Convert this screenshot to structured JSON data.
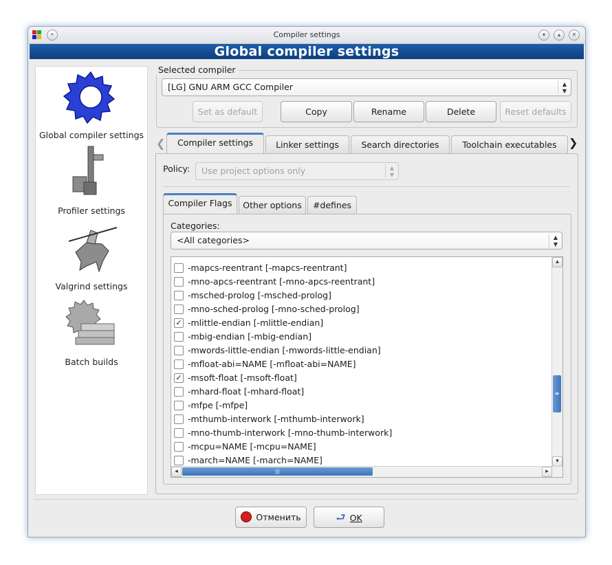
{
  "window": {
    "title": "Compiler settings",
    "banner": "Global compiler settings"
  },
  "sidebar": {
    "items": [
      {
        "label": "Global compiler settings",
        "icon": "gear-icon"
      },
      {
        "label": "Profiler settings",
        "icon": "profiler-icon"
      },
      {
        "label": "Valgrind settings",
        "icon": "valgrind-icon"
      },
      {
        "label": "Batch builds",
        "icon": "batch-builds-icon"
      }
    ]
  },
  "selected_compiler": {
    "legend": "Selected compiler",
    "value": "[LG] GNU ARM GCC Compiler",
    "buttons": {
      "set_default": "Set as default",
      "copy": "Copy",
      "rename": "Rename",
      "delete": "Delete",
      "reset_defaults": "Reset defaults"
    }
  },
  "tabs": [
    "Compiler settings",
    "Linker settings",
    "Search directories",
    "Toolchain executables"
  ],
  "policy": {
    "label": "Policy:",
    "value": "Use project options only"
  },
  "subtabs": [
    "Compiler Flags",
    "Other options",
    "#defines"
  ],
  "categories": {
    "label": "Categories:",
    "value": "<All categories>"
  },
  "flags": [
    {
      "text": "-mapcs-reentrant  [-mapcs-reentrant]",
      "checked": false
    },
    {
      "text": "-mno-apcs-reentrant  [-mno-apcs-reentrant]",
      "checked": false
    },
    {
      "text": "-msched-prolog  [-msched-prolog]",
      "checked": false
    },
    {
      "text": "-mno-sched-prolog  [-mno-sched-prolog]",
      "checked": false
    },
    {
      "text": "-mlittle-endian  [-mlittle-endian]",
      "checked": true
    },
    {
      "text": "-mbig-endian  [-mbig-endian]",
      "checked": false
    },
    {
      "text": "-mwords-little-endian  [-mwords-little-endian]",
      "checked": false
    },
    {
      "text": "-mfloat-abi=NAME  [-mfloat-abi=NAME]",
      "checked": false
    },
    {
      "text": "-msoft-float  [-msoft-float]",
      "checked": true
    },
    {
      "text": "-mhard-float  [-mhard-float]",
      "checked": false
    },
    {
      "text": "-mfpe  [-mfpe]",
      "checked": false
    },
    {
      "text": "-mthumb-interwork  [-mthumb-interwork]",
      "checked": false
    },
    {
      "text": "-mno-thumb-interwork  [-mno-thumb-interwork]",
      "checked": false
    },
    {
      "text": "-mcpu=NAME  [-mcpu=NAME]",
      "checked": false
    },
    {
      "text": "-march=NAME  [-march=NAME]",
      "checked": false
    }
  ],
  "footer": {
    "cancel_label": "Отменить",
    "ok_label": "OK"
  },
  "colors": {
    "banner": "#1f5ea8",
    "accent_tab": "#4a7fc0",
    "cancel_icon": "#d42020"
  }
}
